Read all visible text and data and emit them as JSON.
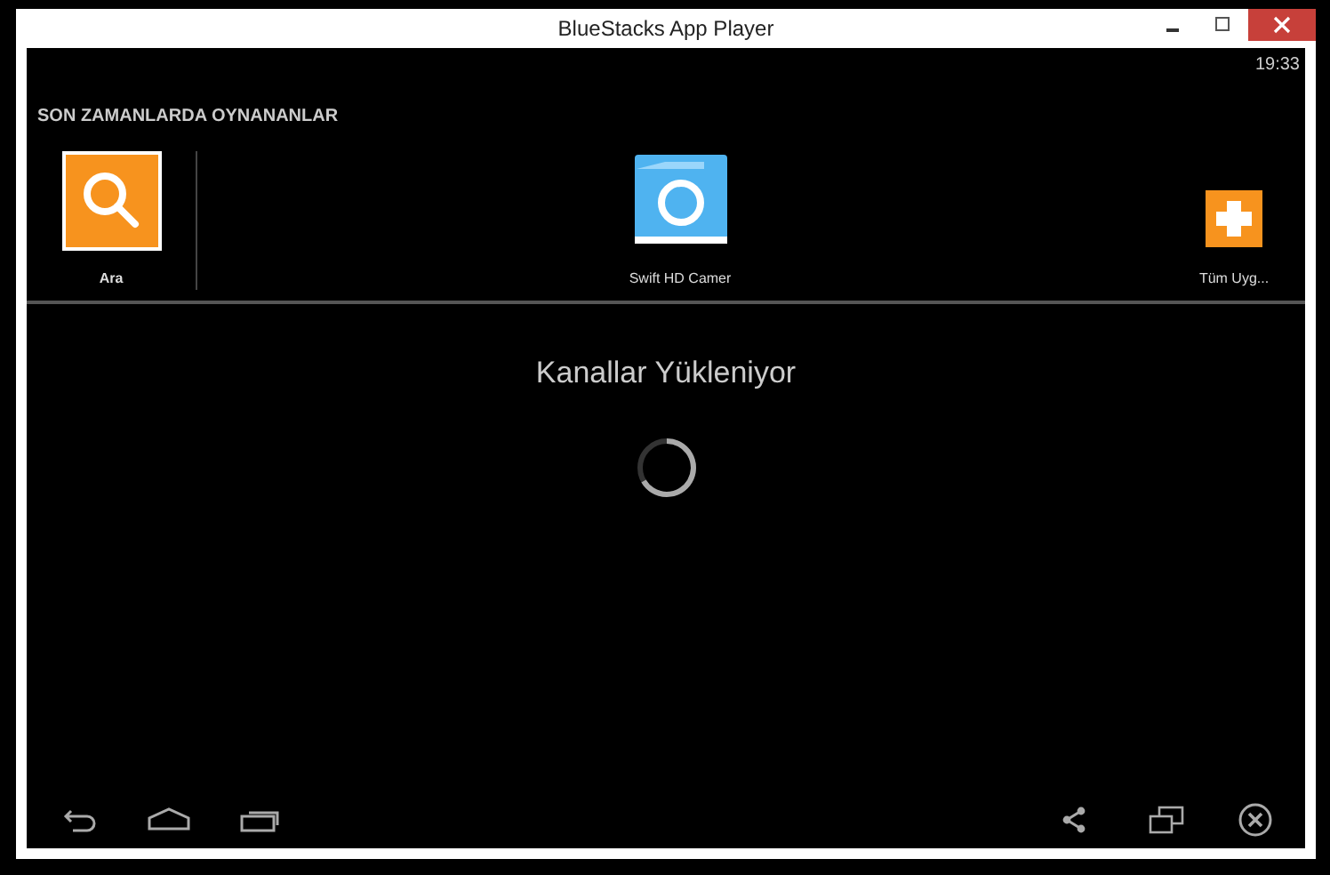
{
  "window": {
    "title": "BlueStacks App Player"
  },
  "status_bar": {
    "time": "19:33"
  },
  "recent": {
    "heading": "SON ZAMANLARDA OYNANANLAR",
    "apps": [
      {
        "kind": "search",
        "label": "Ara"
      },
      {
        "kind": "camera",
        "label": "Swift HD Camer"
      },
      {
        "kind": "all",
        "label": "Tüm Uyg..."
      }
    ]
  },
  "loading": {
    "message": "Kanallar Yükleniyor"
  }
}
